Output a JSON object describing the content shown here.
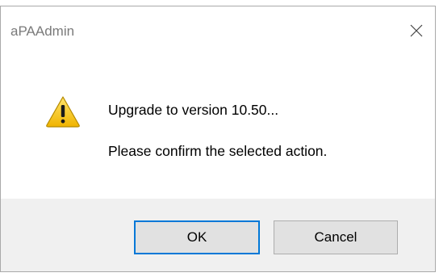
{
  "window": {
    "title": "aPAAdmin",
    "close_icon": "close-icon"
  },
  "message": {
    "icon": "warning-icon",
    "line1": "Upgrade to version 10.50...",
    "line2": "Please confirm the selected action."
  },
  "buttons": {
    "ok_label": "OK",
    "cancel_label": "Cancel"
  },
  "colors": {
    "warning_fill": "#f5c400",
    "focus_border": "#0078d7",
    "footer_bg": "#f0f0f0"
  }
}
